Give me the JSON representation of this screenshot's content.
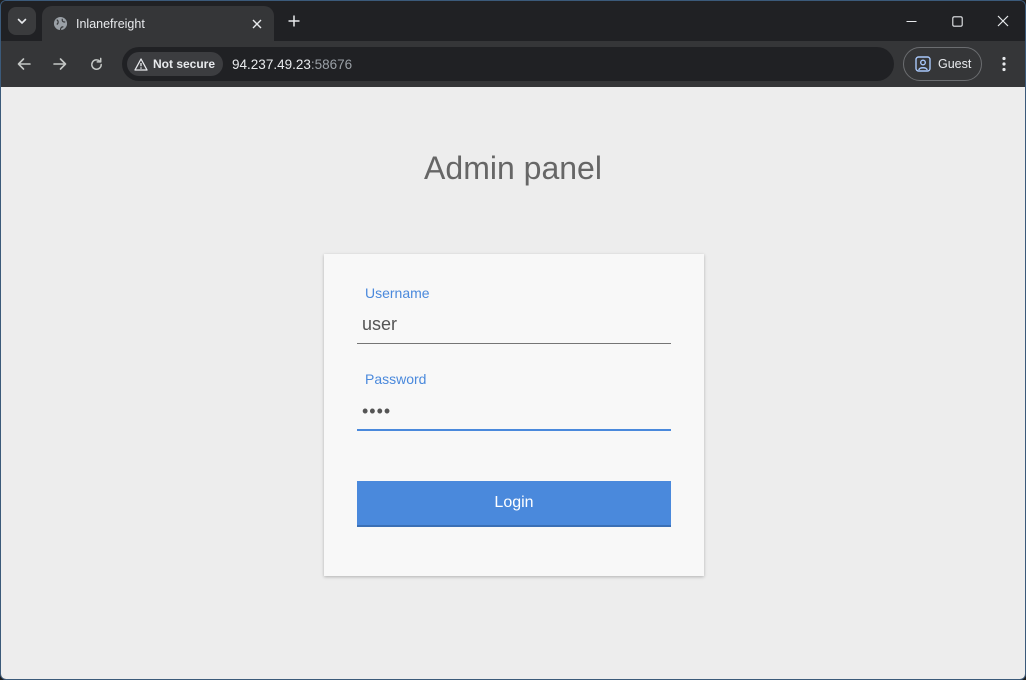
{
  "browser": {
    "tab_title": "Inlanefreight",
    "security_label": "Not secure",
    "url_host": "94.237.49.23",
    "url_port": ":58676",
    "profile_label": "Guest"
  },
  "page": {
    "title": "Admin panel",
    "username_label": "Username",
    "username_value": "user",
    "password_label": "Password",
    "password_value": "••••",
    "login_label": "Login"
  },
  "colors": {
    "accent": "#4a89dc",
    "page_background": "#ededed",
    "card_background": "#f8f8f8"
  }
}
